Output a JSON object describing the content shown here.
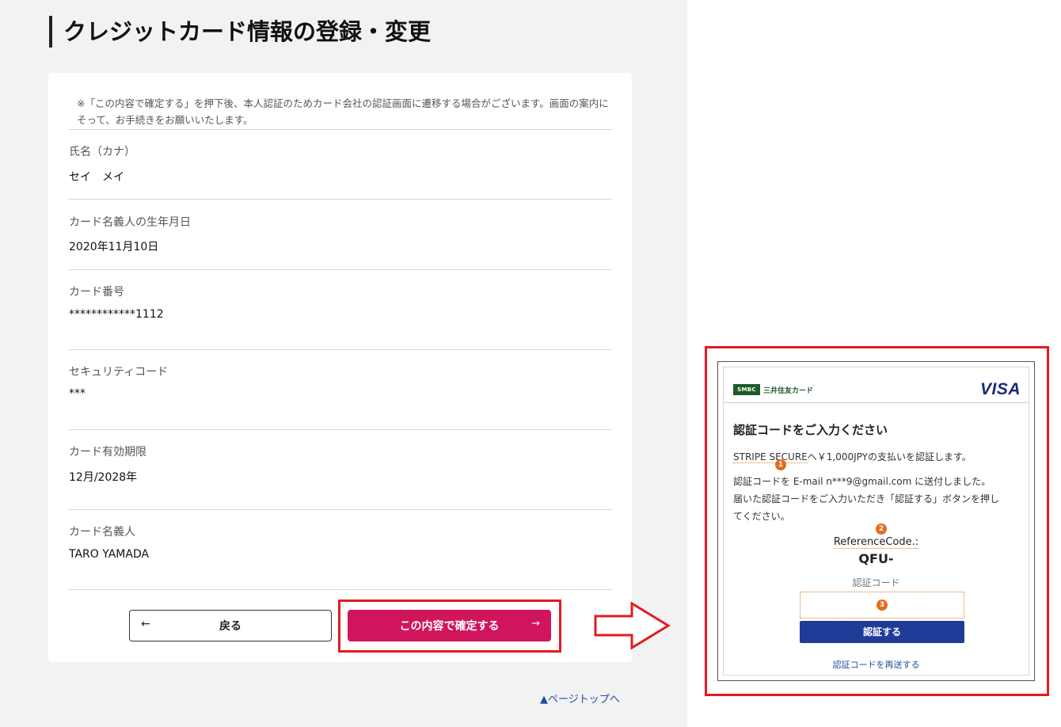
{
  "page": {
    "title": "クレジットカード情報の登録・変更",
    "notice": "※「この内容で確定する」を押下後、本人認証のためカード会社の認証画面に遷移する場合がございます。画面の案内にそって、お手続きをお願いいたします。"
  },
  "fields": [
    {
      "label": "氏名（カナ）",
      "value": "セイ　メイ"
    },
    {
      "label": "カード名義人の生年月日",
      "value": "2020年11月10日"
    },
    {
      "label": "カード番号",
      "value": "************1112"
    },
    {
      "label": "セキュリティコード",
      "value": "***"
    },
    {
      "label": "カード有効期限",
      "value": "12月/2028年"
    },
    {
      "label": "カード名義人",
      "value": "TARO YAMADA"
    }
  ],
  "buttons": {
    "back_label": "戻る",
    "back_arrow": "←",
    "confirm_label": "この内容で確定する",
    "confirm_arrow": "→"
  },
  "page_top_link": "▲ページトップへ",
  "auth_dialog": {
    "issuer_badge": "SMBC",
    "issuer_name": "三井住友カード",
    "brand": "VISA",
    "heading": "認証コードをご入力ください",
    "merchant": "STRIPE SECURE",
    "payment_text": "へ￥1,000JPYの支払いを認証します。",
    "sent_line_prefix": "認証コードを ",
    "sent_email": "E-mail n***9@gmail.com",
    "sent_line_suffix": " に送付しました。",
    "instruction_line1": "届いた認証コードをご入力いただき「認証する」ボタンを押し",
    "instruction_line2": "てください。",
    "reference_label": "ReferenceCode.:",
    "reference_value": "QFU-",
    "code_label": "認証コード",
    "code_value": "",
    "submit_label": "認証する",
    "resend_label": "認証コードを再送する",
    "markers": [
      "1",
      "2",
      "3"
    ]
  },
  "colors": {
    "primary_button": "#d0155c",
    "highlight_border": "#e21b23",
    "auth_button": "#1f3c99",
    "marker": "#e36c1b",
    "link": "#1d4ea0"
  }
}
